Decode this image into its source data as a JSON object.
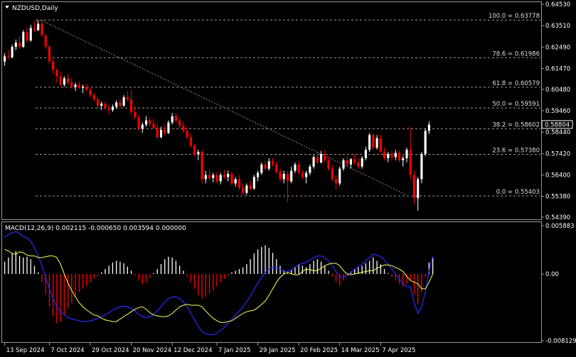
{
  "chart_data": [
    {
      "type": "candlestick",
      "symbol_label": "NZDUSD,Daily",
      "ylim": [
        0.5439,
        0.6453
      ],
      "y_ticks": [
        "0.64530",
        "0.63510",
        "0.62490",
        "0.61470",
        "0.60480",
        "0.59460",
        "0.58440",
        "0.57420",
        "0.56400",
        "0.55380",
        "0.54390"
      ],
      "x_labels": [
        "13 Sep 2024",
        "7 Oct 2024",
        "29 Oct 2024",
        "20 Nov 2024",
        "12 Dec 2024",
        "7 Jan 2025",
        "29 Jan 2025",
        "20 Feb 2025",
        "14 Mar 2025",
        "7 Apr 2025"
      ],
      "current_price": "0.58804",
      "current_value": 0.58804,
      "fib_levels": [
        {
          "label": "100.0 = 0.63778",
          "value": 0.63778
        },
        {
          "label": "78.6 = 0.61986",
          "value": 0.61986
        },
        {
          "label": "61.8 = 0.60579",
          "value": 0.60579
        },
        {
          "label": "50.0 = 0.59591",
          "value": 0.59591
        },
        {
          "label": "38.2 = 0.58602",
          "value": 0.58602
        },
        {
          "label": "23.6 = 0.57380",
          "value": 0.5738
        },
        {
          "label": "0.0 = 0.55403",
          "value": 0.55403
        }
      ],
      "trendline": {
        "from": {
          "index": 10,
          "value": 0.6375
        },
        "to": {
          "index": 108,
          "value": 0.5545
        }
      },
      "ohlc": [
        [
          0.618,
          0.622,
          0.616,
          0.6205
        ],
        [
          0.6205,
          0.6235,
          0.619,
          0.62
        ],
        [
          0.62,
          0.626,
          0.6195,
          0.625
        ],
        [
          0.625,
          0.6285,
          0.6235,
          0.627
        ],
        [
          0.627,
          0.63,
          0.624,
          0.625
        ],
        [
          0.625,
          0.633,
          0.6245,
          0.632
        ],
        [
          0.632,
          0.6345,
          0.627,
          0.628
        ],
        [
          0.628,
          0.6355,
          0.6275,
          0.634
        ],
        [
          0.634,
          0.6372,
          0.632,
          0.633
        ],
        [
          0.633,
          0.6378,
          0.6325,
          0.636
        ],
        [
          0.636,
          0.6378,
          0.63,
          0.6305
        ],
        [
          0.6305,
          0.631,
          0.624,
          0.625
        ],
        [
          0.625,
          0.626,
          0.617,
          0.618
        ],
        [
          0.618,
          0.62,
          0.612,
          0.614
        ],
        [
          0.614,
          0.615,
          0.608,
          0.611
        ],
        [
          0.611,
          0.613,
          0.606,
          0.607
        ],
        [
          0.607,
          0.611,
          0.606,
          0.61
        ],
        [
          0.61,
          0.612,
          0.607,
          0.608
        ],
        [
          0.608,
          0.61,
          0.605,
          0.606
        ],
        [
          0.606,
          0.608,
          0.604,
          0.607
        ],
        [
          0.607,
          0.6085,
          0.605,
          0.6055
        ],
        [
          0.6055,
          0.607,
          0.603,
          0.606
        ],
        [
          0.606,
          0.6075,
          0.604,
          0.6045
        ],
        [
          0.6045,
          0.6055,
          0.601,
          0.602
        ],
        [
          0.602,
          0.603,
          0.599,
          0.6
        ],
        [
          0.6,
          0.601,
          0.596,
          0.597
        ],
        [
          0.597,
          0.599,
          0.595,
          0.598
        ],
        [
          0.598,
          0.599,
          0.595,
          0.596
        ],
        [
          0.596,
          0.5975,
          0.593,
          0.595
        ],
        [
          0.595,
          0.5975,
          0.594,
          0.5965
        ],
        [
          0.5965,
          0.5995,
          0.5955,
          0.5985
        ],
        [
          0.5985,
          0.6,
          0.596,
          0.597
        ],
        [
          0.597,
          0.602,
          0.5965,
          0.601
        ],
        [
          0.601,
          0.604,
          0.599,
          0.6
        ],
        [
          0.6,
          0.6045,
          0.5925,
          0.594
        ],
        [
          0.594,
          0.5965,
          0.5905,
          0.5915
        ],
        [
          0.5915,
          0.593,
          0.585,
          0.586
        ],
        [
          0.586,
          0.589,
          0.584,
          0.588
        ],
        [
          0.588,
          0.592,
          0.587,
          0.59
        ],
        [
          0.59,
          0.5915,
          0.587,
          0.5885
        ],
        [
          0.5885,
          0.591,
          0.586,
          0.5865
        ],
        [
          0.5865,
          0.588,
          0.581,
          0.582
        ],
        [
          0.582,
          0.587,
          0.5815,
          0.5855
        ],
        [
          0.5855,
          0.588,
          0.583,
          0.584
        ],
        [
          0.584,
          0.59,
          0.5835,
          0.589
        ],
        [
          0.589,
          0.5935,
          0.588,
          0.592
        ],
        [
          0.592,
          0.5935,
          0.589,
          0.59
        ],
        [
          0.59,
          0.5915,
          0.5865,
          0.5875
        ],
        [
          0.5875,
          0.5895,
          0.584,
          0.585
        ],
        [
          0.585,
          0.587,
          0.581,
          0.582
        ],
        [
          0.582,
          0.584,
          0.577,
          0.578
        ],
        [
          0.578,
          0.579,
          0.573,
          0.574
        ],
        [
          0.574,
          0.576,
          0.571,
          0.575
        ],
        [
          0.575,
          0.576,
          0.56,
          0.562
        ],
        [
          0.562,
          0.566,
          0.56,
          0.564
        ],
        [
          0.564,
          0.5665,
          0.5615,
          0.5625
        ],
        [
          0.5625,
          0.565,
          0.5605,
          0.564
        ],
        [
          0.564,
          0.5655,
          0.56,
          0.561
        ],
        [
          0.561,
          0.565,
          0.5595,
          0.564
        ],
        [
          0.564,
          0.5665,
          0.562,
          0.563
        ],
        [
          0.563,
          0.566,
          0.561,
          0.5645
        ],
        [
          0.5645,
          0.5655,
          0.559,
          0.56
        ],
        [
          0.56,
          0.563,
          0.5585,
          0.562
        ],
        [
          0.562,
          0.564,
          0.557,
          0.558
        ],
        [
          0.558,
          0.56,
          0.5545,
          0.5555
        ],
        [
          0.5555,
          0.56,
          0.5545,
          0.559
        ],
        [
          0.559,
          0.561,
          0.5565,
          0.5575
        ],
        [
          0.5575,
          0.564,
          0.557,
          0.563
        ],
        [
          0.563,
          0.566,
          0.561,
          0.565
        ],
        [
          0.565,
          0.57,
          0.564,
          0.569
        ],
        [
          0.569,
          0.571,
          0.566,
          0.567
        ],
        [
          0.567,
          0.572,
          0.566,
          0.5705
        ],
        [
          0.5705,
          0.572,
          0.568,
          0.569
        ],
        [
          0.569,
          0.5705,
          0.5645,
          0.5655
        ],
        [
          0.5655,
          0.567,
          0.561,
          0.562
        ],
        [
          0.562,
          0.566,
          0.56,
          0.5645
        ],
        [
          0.5645,
          0.566,
          0.551,
          0.561
        ],
        [
          0.561,
          0.568,
          0.56,
          0.566
        ],
        [
          0.566,
          0.57,
          0.565,
          0.569
        ],
        [
          0.569,
          0.5705,
          0.564,
          0.565
        ],
        [
          0.565,
          0.5665,
          0.562,
          0.563
        ],
        [
          0.563,
          0.566,
          0.56,
          0.565
        ],
        [
          0.565,
          0.569,
          0.564,
          0.568
        ],
        [
          0.568,
          0.5735,
          0.567,
          0.5725
        ],
        [
          0.5725,
          0.5745,
          0.569,
          0.57
        ],
        [
          0.57,
          0.5755,
          0.5695,
          0.574
        ],
        [
          0.574,
          0.576,
          0.57,
          0.571
        ],
        [
          0.571,
          0.5725,
          0.566,
          0.567
        ],
        [
          0.567,
          0.569,
          0.561,
          0.562
        ],
        [
          0.562,
          0.564,
          0.557,
          0.56
        ],
        [
          0.56,
          0.568,
          0.559,
          0.567
        ],
        [
          0.567,
          0.572,
          0.566,
          0.571
        ],
        [
          0.571,
          0.573,
          0.568,
          0.569
        ],
        [
          0.569,
          0.572,
          0.567,
          0.5715
        ],
        [
          0.5715,
          0.574,
          0.569,
          0.57
        ],
        [
          0.57,
          0.572,
          0.567,
          0.568
        ],
        [
          0.568,
          0.573,
          0.567,
          0.572
        ],
        [
          0.572,
          0.5775,
          0.571,
          0.576
        ],
        [
          0.576,
          0.584,
          0.575,
          0.583
        ],
        [
          0.583,
          0.584,
          0.576,
          0.577
        ],
        [
          0.577,
          0.583,
          0.576,
          0.5815
        ],
        [
          0.5815,
          0.583,
          0.574,
          0.575
        ],
        [
          0.575,
          0.577,
          0.571,
          0.572
        ],
        [
          0.572,
          0.575,
          0.57,
          0.574
        ],
        [
          0.574,
          0.5755,
          0.571,
          0.5725
        ],
        [
          0.5725,
          0.576,
          0.571,
          0.5745
        ],
        [
          0.5745,
          0.576,
          0.57,
          0.571
        ],
        [
          0.571,
          0.573,
          0.568,
          0.572
        ],
        [
          0.572,
          0.577,
          0.57,
          0.576
        ],
        [
          0.576,
          0.587,
          0.562,
          0.564
        ],
        [
          0.564,
          0.566,
          0.55,
          0.553
        ],
        [
          0.553,
          0.563,
          0.547,
          0.562
        ],
        [
          0.562,
          0.575,
          0.56,
          0.574
        ],
        [
          0.574,
          0.586,
          0.573,
          0.585
        ],
        [
          0.585,
          0.5895,
          0.5835,
          0.588
        ]
      ]
    },
    {
      "type": "bar+line",
      "indicator_label": "MACD(12,26,9) 0.002115 -0.000650 0.003594 0.000000",
      "ylim": [
        -0.008129,
        0.005883
      ],
      "y_ticks": [
        "0.005883",
        "0.00",
        "-0.008129"
      ],
      "series": [
        {
          "kind": "histogram",
          "values": [
            0.0015,
            0.002,
            0.0025,
            0.0028,
            0.0022,
            0.002,
            0.0021,
            0.0018,
            0.001,
            0.0002,
            -0.001,
            -0.0025,
            -0.004,
            -0.0052,
            -0.006,
            -0.0058,
            -0.005,
            -0.0042,
            -0.0035,
            -0.0028,
            -0.0022,
            -0.0018,
            -0.0014,
            -0.001,
            -0.0006,
            -0.0003,
            0.0002,
            0.0006,
            0.001,
            0.0014,
            0.0016,
            0.0015,
            0.0013,
            0.0009,
            0.0004,
            -0.0002,
            -0.0008,
            -0.0012,
            -0.001,
            -0.0005,
            0.0001,
            0.0006,
            0.0012,
            0.0018,
            0.0021,
            0.002,
            0.0016,
            0.001,
            0.0004,
            -0.0003,
            -0.001,
            -0.0018,
            -0.0026,
            -0.003,
            -0.0028,
            -0.0024,
            -0.002,
            -0.0015,
            -0.001,
            -0.0006,
            -0.0002,
            0.0002,
            0.0004,
            0.0006,
            0.0008,
            0.0012,
            0.0018,
            0.0025,
            0.003,
            0.0033,
            0.0035,
            0.0032,
            0.0026,
            0.0018,
            0.001,
            0.0004,
            0.0001,
            0.0005,
            0.0009,
            0.0012,
            0.001,
            0.0008,
            0.0012,
            0.0016,
            0.0018,
            0.0015,
            0.001,
            0.0004,
            -0.0003,
            -0.001,
            -0.0014,
            -0.0008,
            -0.0002,
            0.0003,
            0.0006,
            0.0008,
            0.001,
            0.0013,
            0.0016,
            0.002,
            0.0016,
            0.0012,
            0.0006,
            0.0001,
            -0.0004,
            -0.0008,
            -0.0012,
            -0.0015,
            -0.0012,
            -0.0008,
            -0.0025,
            -0.0036,
            -0.0022,
            -0.0004,
            0.0014,
            0.0021
          ]
        },
        {
          "kind": "macd-line",
          "values": [
            0.0045,
            0.0048,
            0.005,
            0.0052,
            0.0049,
            0.0046,
            0.0044,
            0.004,
            0.0032,
            0.0022,
            0.001,
            -0.0004,
            -0.0018,
            -0.003,
            -0.004,
            -0.0046,
            -0.005,
            -0.0053,
            -0.0055,
            -0.0056,
            -0.0057,
            -0.0058,
            -0.0058,
            -0.0057,
            -0.0056,
            -0.0054,
            -0.0052,
            -0.005,
            -0.0047,
            -0.0044,
            -0.0042,
            -0.004,
            -0.0039,
            -0.004,
            -0.0042,
            -0.0045,
            -0.0049,
            -0.0052,
            -0.0053,
            -0.0052,
            -0.0049,
            -0.0045,
            -0.004,
            -0.0034,
            -0.003,
            -0.0028,
            -0.0028,
            -0.003,
            -0.0034,
            -0.004,
            -0.0048,
            -0.0056,
            -0.0064,
            -0.007,
            -0.0073,
            -0.0074,
            -0.0074,
            -0.0072,
            -0.0069,
            -0.0065,
            -0.006,
            -0.0055,
            -0.005,
            -0.0045,
            -0.004,
            -0.0034,
            -0.0027,
            -0.0019,
            -0.0011,
            -0.0004,
            0.0002,
            0.0006,
            0.0008,
            0.0008,
            0.0006,
            0.0004,
            0.0003,
            0.0005,
            0.0008,
            0.0011,
            0.0013,
            0.0014,
            0.0017,
            0.002,
            0.0022,
            0.0022,
            0.002,
            0.0016,
            0.001,
            0.0003,
            -0.0004,
            -0.0004,
            -0.0002,
            0.0002,
            0.0006,
            0.0009,
            0.0012,
            0.0016,
            0.002,
            0.0024,
            0.0023,
            0.0021,
            0.0017,
            0.0012,
            0.0006,
            0.0,
            -0.0006,
            -0.0012,
            -0.0015,
            -0.0016,
            -0.0035,
            -0.0048,
            -0.004,
            -0.0022,
            0.0004,
            0.0021
          ]
        },
        {
          "kind": "signal-line",
          "values": [
            0.003,
            0.0028,
            0.0025,
            0.0024,
            0.0027,
            0.0026,
            0.0023,
            0.0022,
            0.0022,
            0.002,
            0.002,
            0.0021,
            0.0022,
            0.0022,
            0.002,
            0.0012,
            0.0,
            -0.0011,
            -0.002,
            -0.0028,
            -0.0035,
            -0.004,
            -0.0044,
            -0.0047,
            -0.005,
            -0.0051,
            -0.0054,
            -0.0056,
            -0.0057,
            -0.0058,
            -0.0058,
            -0.0055,
            -0.0052,
            -0.0049,
            -0.0046,
            -0.0043,
            -0.0041,
            -0.004,
            -0.0043,
            -0.0047,
            -0.005,
            -0.0051,
            -0.0052,
            -0.0052,
            -0.0051,
            -0.0048,
            -0.0044,
            -0.004,
            -0.0038,
            -0.0037,
            -0.0038,
            -0.0038,
            -0.0038,
            -0.004,
            -0.0045,
            -0.005,
            -0.0054,
            -0.0057,
            -0.0059,
            -0.0059,
            -0.0058,
            -0.0057,
            -0.0054,
            -0.0051,
            -0.0048,
            -0.0046,
            -0.0045,
            -0.0044,
            -0.0041,
            -0.0037,
            -0.0033,
            -0.0026,
            -0.0018,
            -0.001,
            -0.0004,
            0.0,
            0.0002,
            0.0,
            -0.0001,
            -0.0001,
            0.0003,
            0.0006,
            0.0005,
            0.0004,
            0.0004,
            0.0007,
            0.001,
            0.0012,
            0.0013,
            0.0013,
            0.001,
            0.0004,
            0.0,
            -0.0001,
            0.0,
            0.0001,
            0.0002,
            0.0003,
            0.0004,
            0.0004,
            0.0007,
            0.0009,
            0.0011,
            0.0011,
            0.001,
            0.0008,
            0.0006,
            0.0003,
            -0.0003,
            -0.0008,
            -0.001,
            -0.0012,
            -0.0018,
            -0.0018,
            -0.001,
            0.0
          ]
        }
      ]
    }
  ],
  "colors": {
    "background": "#000000",
    "bull": "#ffffff",
    "bear": "#ff0000",
    "grid": "#9a9a9a",
    "macd_line": "#2a2aff",
    "signal_line": "#ffff55",
    "trendline": "#8a8a8a",
    "axis_text": "#ffffff"
  }
}
